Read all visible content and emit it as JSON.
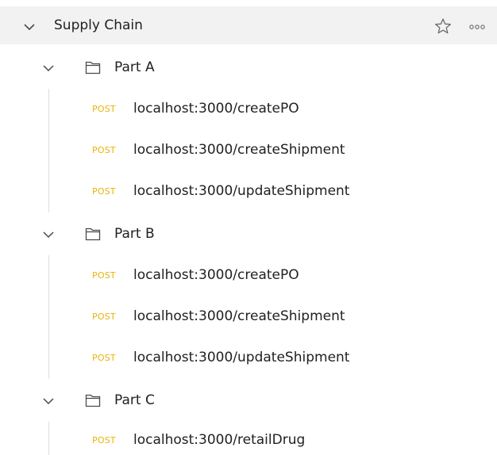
{
  "collection": {
    "title": "Supply Chain",
    "icons": {
      "expand": "chevron-down-icon",
      "favorite": "star-icon",
      "more": "more-options-icon"
    }
  },
  "folders": [
    {
      "label": "Part A",
      "requests": [
        {
          "method": "POST",
          "url": "localhost:3000/createPO"
        },
        {
          "method": "POST",
          "url": "localhost:3000/createShipment"
        },
        {
          "method": "POST",
          "url": "localhost:3000/updateShipment"
        }
      ]
    },
    {
      "label": "Part B",
      "requests": [
        {
          "method": "POST",
          "url": "localhost:3000/createPO"
        },
        {
          "method": "POST",
          "url": "localhost:3000/createShipment"
        },
        {
          "method": "POST",
          "url": "localhost:3000/updateShipment"
        }
      ]
    },
    {
      "label": "Part C",
      "requests": [
        {
          "method": "POST",
          "url": "localhost:3000/retailDrug"
        }
      ]
    }
  ],
  "colors": {
    "header_bg": "#f2f2f2",
    "method_post": "#eab308",
    "text": "#212121",
    "guide": "#dedede"
  }
}
